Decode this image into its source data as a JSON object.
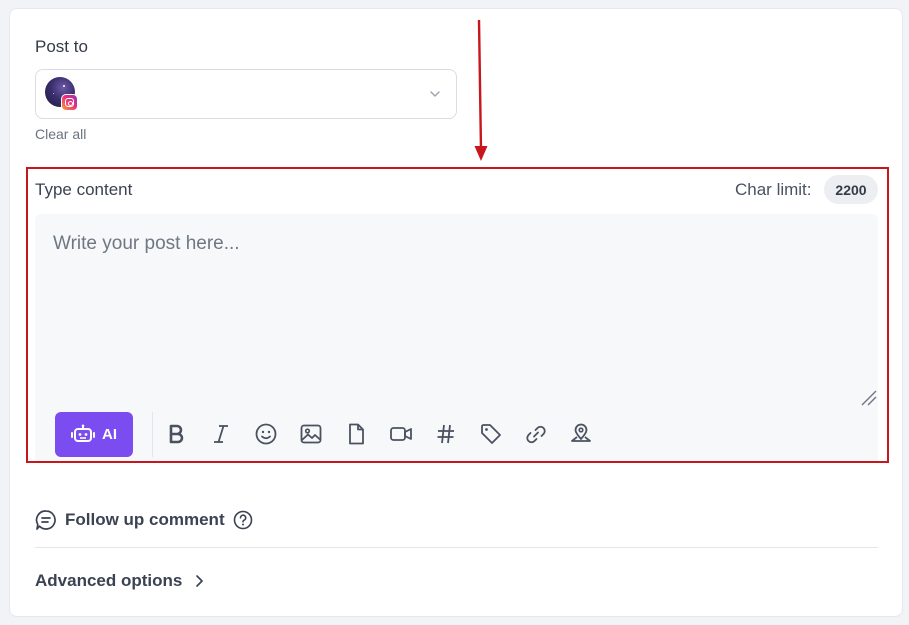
{
  "post_to": {
    "label": "Post to",
    "selected_account": {
      "avatar_icon": "account-avatar",
      "network_icon": "instagram-icon"
    },
    "dropdown_icon": "chevron-down-icon",
    "clear_all": "Clear all"
  },
  "content": {
    "label": "Type content",
    "char_limit_label": "Char limit:",
    "char_limit_value": "2200",
    "placeholder": "Write your post here...",
    "value": ""
  },
  "toolbar": {
    "ai_label": "AI",
    "tools": [
      "bold-icon",
      "italic-icon",
      "emoji-icon",
      "image-icon",
      "file-icon",
      "video-icon",
      "hashtag-icon",
      "tag-icon",
      "link-icon",
      "location-icon"
    ]
  },
  "followup": {
    "label": "Follow up comment"
  },
  "advanced": {
    "label": "Advanced options"
  },
  "annotation": {
    "color": "#c8161d"
  },
  "colors": {
    "accent": "#7b4cf0",
    "text": "#3b4252",
    "muted": "#6f7784"
  }
}
